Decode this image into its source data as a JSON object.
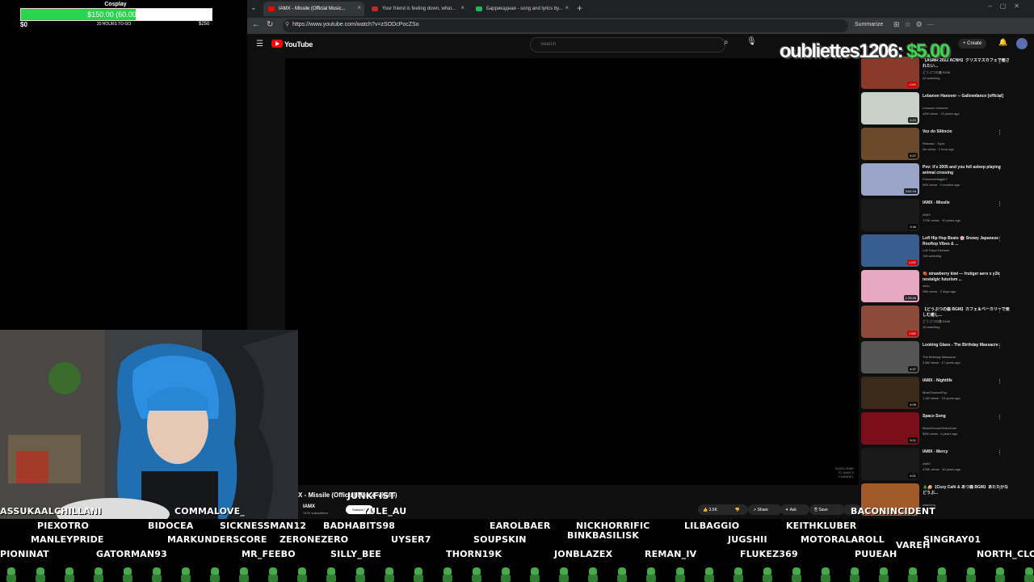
{
  "goal": {
    "title": "Cosplay",
    "amount": "$150.00 (60.00%)",
    "progress": 0.6,
    "min": "$0",
    "remaining": "20 HOURS TO GO",
    "max": "$250"
  },
  "browser": {
    "tabs": [
      {
        "label": "IAMX - Missile (Official Music...",
        "color": "#ff0000"
      },
      {
        "label": "Your friend is feeling down, what...",
        "color": "#c62828"
      },
      {
        "label": "Баррикадная - song and lyrics by...",
        "color": "#1db954"
      }
    ],
    "url": "https://www.youtube.com/watch?v=zSODcPocZSo",
    "summarize": "Summarize"
  },
  "youtube": {
    "brand": "YouTube",
    "search_placeholder": "Search",
    "create_label": "+ Create",
    "video_title": "X - Missile (Official Music Video)",
    "channel": "IAMX",
    "subscribers": "137K subscribers",
    "subscribe_label": "Subscribe",
    "like_count": "3.5K",
    "share_label": "Share",
    "ask_label": "Ask",
    "save_label": "Save",
    "player_watermark": "SUBSCRIBE TO IAMX'S CHANNEL"
  },
  "donation": {
    "user": "oubliettes1206:",
    "amount": "$5.00"
  },
  "recommendations": [
    {
      "title": "【ASMR 2022 ACNH】クリスマスカフェで癒されたい...",
      "channel": "どうぶつの森 BGM",
      "meta": "42 watching",
      "badge": "LIVE",
      "thumb": "#8a3a2a"
    },
    {
      "title": "Lebanon Hanover -- Gallowdance [official]",
      "channel": "Lebanon Hanover",
      "meta": "42M views · 13 years ago",
      "badge": "4:24",
      "thumb": "#c9d2c8"
    },
    {
      "title": "Voz do Silêncio",
      "channel": "Release - Topic",
      "meta": "No views · 1 hour ago",
      "badge": "4:07",
      "thumb": "#6b4a2b"
    },
    {
      "title": "Pov: it's 2005 and you fell asleep playing animal crossing",
      "channel": "PrincessMaggie7",
      "meta": "50K views · 2 months ago",
      "badge": "3:02:16",
      "thumb": "#9aa3c8"
    },
    {
      "title": "IAMX - Missile",
      "channel": "IAMX",
      "meta": "175K views · 10 years ago",
      "badge": "3:36",
      "thumb": "#1a1a1a"
    },
    {
      "title": "Lofi Hip Hop Beats 🌸 Snowy Japanese Rooftop Vibes & ...",
      "channel": "Lofi Tokyo Dreams",
      "meta": "118 watching",
      "badge": "LIVE",
      "thumb": "#3a5d8f"
    },
    {
      "title": "🍓 strawberry kiwi — frutiger aero x y2k nostalgic futurism ...",
      "channel": "mido",
      "meta": "28K views · 2 days ago",
      "badge": "1:33:28",
      "thumb": "#e8a7c2"
    },
    {
      "title": "【どうぶつの森 BGM】カフェ＆ベーカリーで楽しむ癒し...",
      "channel": "どうぶつの森 BGM",
      "meta": "16 watching",
      "badge": "LIVE",
      "thumb": "#8c4a3a"
    },
    {
      "title": "Looking Glass - The Birthday Massacre",
      "channel": "The Birthday Massacre",
      "meta": "3.6M views · 17 years ago",
      "badge": "4:37",
      "thumb": "#555555"
    },
    {
      "title": "IAMX - Nightlife",
      "channel": "MusiChannelPop",
      "meta": "1.1M views · 15 years ago",
      "badge": "4:09",
      "thumb": "#3a2a1a"
    },
    {
      "title": "Space Song",
      "channel": "BeachHouseVideoZone",
      "meta": "56M views · 6 years ago",
      "badge": "5:21",
      "thumb": "#7a0f1a"
    },
    {
      "title": "IAMX - Mercy",
      "channel": "IAMX",
      "meta": "478K views · 10 years ago",
      "badge": "6:01",
      "thumb": "#1a1a1a"
    },
    {
      "title": "🎄🍰【Cozy Café & あつ森 BGM】あたたかなどうぶ...",
      "channel": "",
      "meta": "watching",
      "badge": "",
      "thumb": "#a05a2a"
    }
  ],
  "chat_names": [
    "ASSUKAALCHILLANI",
    "COMMALOVE_",
    "PIEXOTRO",
    "BIDOCEA",
    "SICKNESSMAN12",
    "BADHABITS98",
    "MANLEYPRIDE",
    "MARKUNDERSCORE",
    "ZERONEZERO",
    "UYSER7",
    "EAROLBAER",
    "NICKHORRIFIC",
    "BINKBASILISK",
    "LILBAGGIO",
    "KEITHKLUBER",
    "SOUPSKIN",
    "JUGSHII",
    "MOTORALAROLL",
    "SINGRAY01",
    "PIONINAT",
    "GATORMAN93",
    "MR_FEEBO",
    "SILLY_BEE",
    "THORN19K",
    "JONBLAZEX",
    "REMAN_IV",
    "FLUKEZ369",
    "PUUEAH",
    "VAREH",
    "NORTH_CLO",
    "JUNKFIST",
    "YULE_AU",
    "BACONINCIDENT"
  ]
}
